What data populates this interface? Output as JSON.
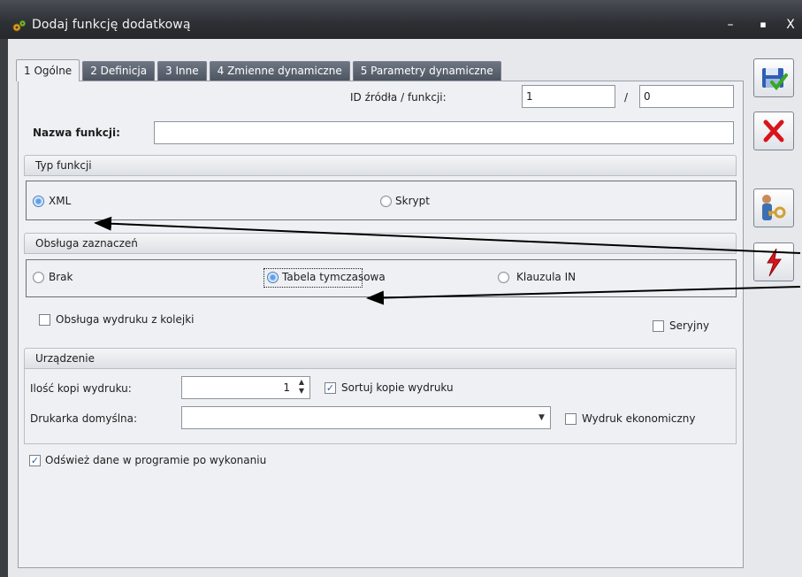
{
  "window": {
    "title": "Dodaj funkcję dodatkową",
    "minimize_glyph": "–",
    "maximize_glyph": "▪",
    "close_glyph": "X"
  },
  "tabs": [
    {
      "label": "1 Ogólne",
      "active": true
    },
    {
      "label": "2 Definicja",
      "active": false
    },
    {
      "label": "3 Inne",
      "active": false
    },
    {
      "label": "4 Zmienne dynamiczne",
      "active": false
    },
    {
      "label": "5 Parametry dynamiczne",
      "active": false
    }
  ],
  "id_section": {
    "label": "ID źródła / funkcji:",
    "source_id": "1",
    "separator": "/",
    "function_id": "0"
  },
  "name_field": {
    "label": "Nazwa funkcji:",
    "value": ""
  },
  "typ_funkcji": {
    "header": "Typ funkcji",
    "options": [
      "XML",
      "Skrypt"
    ],
    "selected": "XML"
  },
  "obsluga_zaznaczen": {
    "header": "Obsługa zaznaczeń",
    "options": [
      "Brak",
      "Tabela tymczasowa",
      "Klauzula IN"
    ],
    "selected": "Tabela tymczasowa"
  },
  "options": {
    "obsluga_wydruku_label": "Obsługa wydruku z kolejki",
    "obsluga_wydruku_checked": false,
    "seryjny_label": "Seryjny",
    "seryjny_checked": false
  },
  "urzadzenie": {
    "header": "Urządzenie",
    "copies_label": "Ilość kopi wydruku:",
    "copies_value": "1",
    "sort_label": "Sortuj kopie wydruku",
    "sort_checked": true,
    "printer_label": "Drukarka domyślna:",
    "printer_value": "",
    "economic_label": "Wydruk ekonomiczny",
    "economic_checked": false
  },
  "refresh": {
    "label": "Odśwież dane w programie po wykonaniu",
    "checked": true
  },
  "toolbar": {
    "icons": [
      "save-icon",
      "cancel-icon",
      "user-key-icon",
      "lightning-icon"
    ]
  },
  "colors": {
    "titlebar": "#2c2f33",
    "tab_inactive": "#5b6370",
    "panel": "#eef0f3",
    "cancel_red": "#d7151b",
    "check_blue": "#2a5da8"
  }
}
